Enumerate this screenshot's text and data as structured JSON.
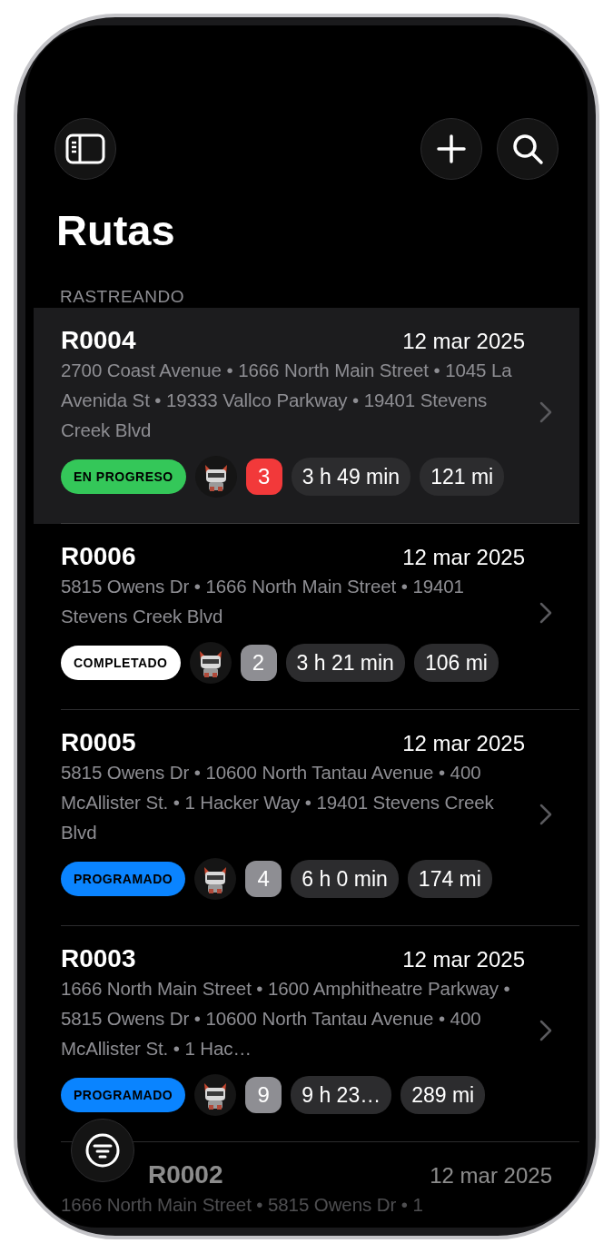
{
  "title": "Rutas",
  "section": "RASTREANDO",
  "routes": [
    {
      "id": "R0004",
      "date": "12 mar 2025",
      "addresses": "2700 Coast Avenue • 1666 North Main Street • 1045 La Avenida St • 19333 Vallco Parkway  • 19401 Stevens Creek Blvd",
      "status": {
        "label": "EN PROGRESO",
        "kind": "progress"
      },
      "count": "3",
      "color": "#f2393a",
      "duration": "3 h 49 min",
      "distance": "121 mi",
      "selected": true,
      "faded": false
    },
    {
      "id": "R0006",
      "date": "12 mar 2025",
      "addresses": "5815 Owens Dr • 1666 North Main Street • 19401 Stevens Creek Blvd",
      "status": {
        "label": "COMPLETADO",
        "kind": "completed"
      },
      "count": "2",
      "color": "#8e8e93",
      "duration": "3 h 21 min",
      "distance": "106 mi",
      "selected": false,
      "faded": false
    },
    {
      "id": "R0005",
      "date": "12 mar 2025",
      "addresses": "5815 Owens Dr • 10600 North Tantau Avenue • 400 McAllister St.  • 1 Hacker Way • 19401 Stevens Creek Blvd",
      "status": {
        "label": "PROGRAMADO",
        "kind": "scheduled"
      },
      "count": "4",
      "color": "#8e8e93",
      "duration": "6 h 0 min",
      "distance": "174 mi",
      "selected": false,
      "faded": false
    },
    {
      "id": "R0003",
      "date": "12 mar 2025",
      "addresses": "1666 North Main Street • 1600 Amphitheatre Parkway • 5815 Owens Dr • 10600 North Tantau Avenue • 400 McAllister St.  • 1 Hac…",
      "status": {
        "label": "PROGRAMADO",
        "kind": "scheduled"
      },
      "count": "9",
      "color": "#8e8e93",
      "duration": "9 h 23…",
      "distance": "289 mi",
      "selected": false,
      "faded": false
    },
    {
      "id": "R0002",
      "date": "12 mar 2025",
      "addresses": "1666 North Main Street • 5815 Owens Dr • 1",
      "selected": false,
      "faded": true
    }
  ]
}
